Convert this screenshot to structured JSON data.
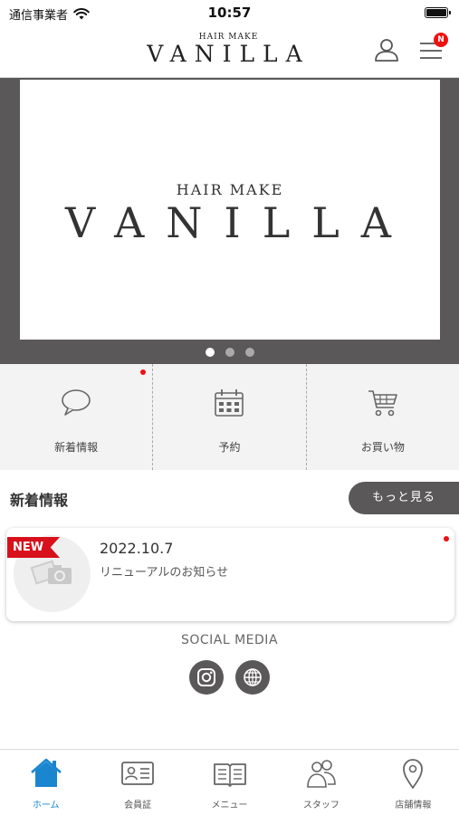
{
  "status_bar": {
    "carrier": "通信事業者",
    "time": "10:57"
  },
  "header": {
    "logo_small": "HAIR MAKE",
    "logo_big": "VANILLA",
    "notification_badge": "N"
  },
  "hero": {
    "logo_small": "HAIR MAKE",
    "logo_big": "VANILLA",
    "slide_count": 3,
    "active_slide": 1
  },
  "quick_menu": [
    {
      "label": "新着情報",
      "icon": "speech-bubble-icon",
      "has_unread": true
    },
    {
      "label": "予約",
      "icon": "calendar-icon",
      "has_unread": false
    },
    {
      "label": "お買い物",
      "icon": "cart-icon",
      "has_unread": false
    }
  ],
  "news": {
    "section_title": "新着情報",
    "more_label": "もっと見る",
    "items": [
      {
        "tag": "NEW",
        "date": "2022.10.7",
        "headline": "リニューアルのお知らせ",
        "unread": true
      }
    ]
  },
  "social": {
    "title": "SOCIAL MEDIA",
    "links": [
      "instagram-icon",
      "globe-icon"
    ]
  },
  "tab_bar": [
    {
      "label": "ホーム",
      "icon": "home-icon",
      "active": true
    },
    {
      "label": "会員証",
      "icon": "member-card-icon",
      "active": false
    },
    {
      "label": "メニュー",
      "icon": "book-icon",
      "active": false
    },
    {
      "label": "スタッフ",
      "icon": "staff-icon",
      "active": false
    },
    {
      "label": "店舗情報",
      "icon": "location-pin-icon",
      "active": false
    }
  ],
  "colors": {
    "accent": "#1a86d0",
    "dark_gray": "#5a5859",
    "alert_red": "#d8101c"
  }
}
